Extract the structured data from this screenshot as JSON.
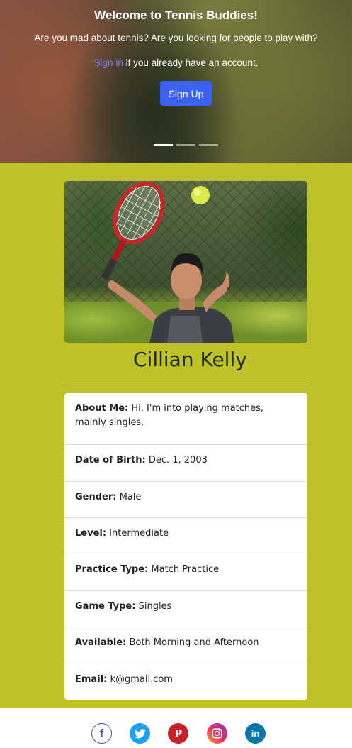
{
  "hero": {
    "title": "Welcome to Tennis Buddies!",
    "subtitle": "Are you mad about tennis? Are you looking for people to play with?",
    "signin_link": "Sign in",
    "signin_rest": " if you already have an account.",
    "signup_label": "Sign Up",
    "slides_total": 3,
    "active_slide": 1
  },
  "profile": {
    "name": "Cillian Kelly",
    "details": [
      {
        "label": "About Me:",
        "value": " Hi, I'm into playing matches, mainly singles."
      },
      {
        "label": "Date of Birth:",
        "value": " Dec. 1, 2003"
      },
      {
        "label": "Gender:",
        "value": " Male"
      },
      {
        "label": "Level:",
        "value": " Intermediate"
      },
      {
        "label": "Practice Type:",
        "value": " Match Practice"
      },
      {
        "label": "Game Type:",
        "value": " Singles"
      },
      {
        "label": "Available:",
        "value": " Both Morning and Afternoon"
      },
      {
        "label": "Email:",
        "value": " k@gmail.com"
      }
    ]
  },
  "footer": {
    "social": [
      {
        "name": "facebook-icon",
        "glyph": "f",
        "color": "#3b5998"
      },
      {
        "name": "twitter-icon",
        "glyph": "",
        "color": "#1da1f2"
      },
      {
        "name": "pinterest-icon",
        "glyph": "P",
        "color": "#cb2027"
      },
      {
        "name": "instagram-icon",
        "glyph": "",
        "color": "#c13584"
      },
      {
        "name": "linkedin-icon",
        "glyph": "in",
        "color": "#0e76a8"
      }
    ]
  },
  "colors": {
    "page_bg": "#bec228",
    "signup_button": "#3b63f3",
    "signin_link": "#6f7dff"
  }
}
